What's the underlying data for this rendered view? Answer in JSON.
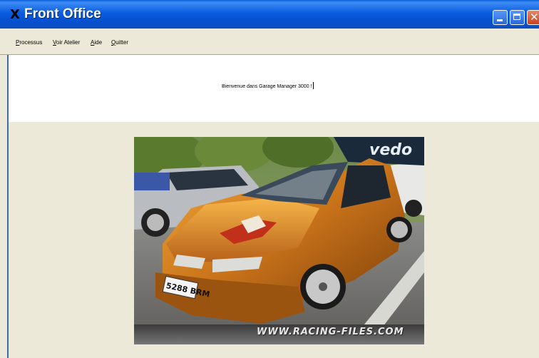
{
  "window": {
    "title": "Front Office",
    "icon": "x-app-icon"
  },
  "menu": {
    "items": [
      {
        "accel": "P",
        "rest": "rocessus"
      },
      {
        "accel": "V",
        "rest": "oir Atelier"
      },
      {
        "accel": "A",
        "rest": "ide"
      },
      {
        "accel": "Q",
        "rest": "uitter"
      }
    ]
  },
  "welcome": {
    "text": "Bienvenue dans Garage Manager 3000 !"
  },
  "photo": {
    "plate": "5288 BRM",
    "watermark": "WWW.RACING-FILES.COM",
    "banner": "vedo"
  },
  "colors": {
    "titlebar": "#0b5ce0",
    "window_bg": "#ece9d8",
    "car_body": "#c87a10"
  }
}
